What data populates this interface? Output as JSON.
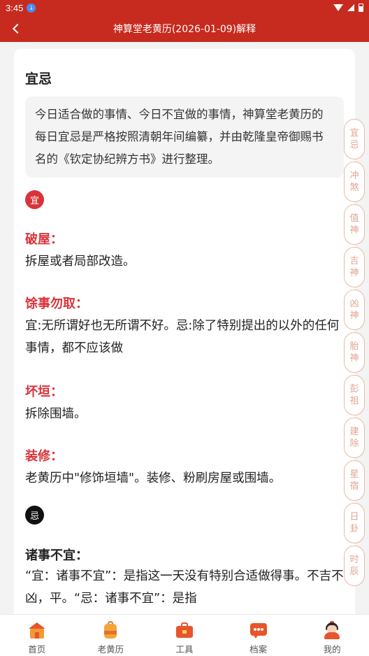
{
  "status_bar": {
    "time": "3:45",
    "notif_glyph": "↓"
  },
  "header": {
    "title": "神算堂老黄历(2026-01-09)解释"
  },
  "section": {
    "title": "宜忌",
    "intro": "今日适合做的事情、今日不宜做的事情，神算堂老黄历的每日宜忌是严格按照清朝年间编纂，并由乾隆皇帝御赐书名的《钦定协纪辨方书》进行整理。"
  },
  "yi": {
    "badge": "宜",
    "items": [
      {
        "term": "破屋：",
        "desc": "拆屋或者局部改造。"
      },
      {
        "term": "馀事勿取：",
        "desc": "宜:无所谓好也无所谓不好。忌:除了特别提出的以外的任何事情，都不应该做"
      },
      {
        "term": "坏垣：",
        "desc": "拆除围墙。"
      },
      {
        "term": "装修：",
        "desc": "老黄历中\"修饰垣墙\"。装修、粉刷房屋或围墙。"
      }
    ]
  },
  "ji": {
    "badge": "忌",
    "items": [
      {
        "term": "诸事不宜：",
        "desc": "“宜：诸事不宜”：是指这一天没有特别合适做得事。不吉不凶，平。“忌：诸事不宜”：是指"
      }
    ]
  },
  "side_tabs": [
    [
      "宜",
      "忌"
    ],
    [
      "冲",
      "煞"
    ],
    [
      "值",
      "神"
    ],
    [
      "吉",
      "神"
    ],
    [
      "凶",
      "神"
    ],
    [
      "胎",
      "神"
    ],
    [
      "彭",
      "祖"
    ],
    [
      "建",
      "除"
    ],
    [
      "星",
      "宿"
    ],
    [
      "日",
      "卦"
    ],
    [
      "时",
      "辰"
    ]
  ],
  "bottom_nav": [
    {
      "label": "首页",
      "icon": "home-icon"
    },
    {
      "label": "老黄历",
      "icon": "almanac-bag-icon"
    },
    {
      "label": "工具",
      "icon": "toolbox-icon"
    },
    {
      "label": "档案",
      "icon": "chat-bubble-icon"
    },
    {
      "label": "我的",
      "icon": "profile-avatar-icon"
    }
  ],
  "colors": {
    "primary_red": "#c72a1e",
    "term_red": "#d9333a",
    "tab_border": "#e9b9a6"
  }
}
